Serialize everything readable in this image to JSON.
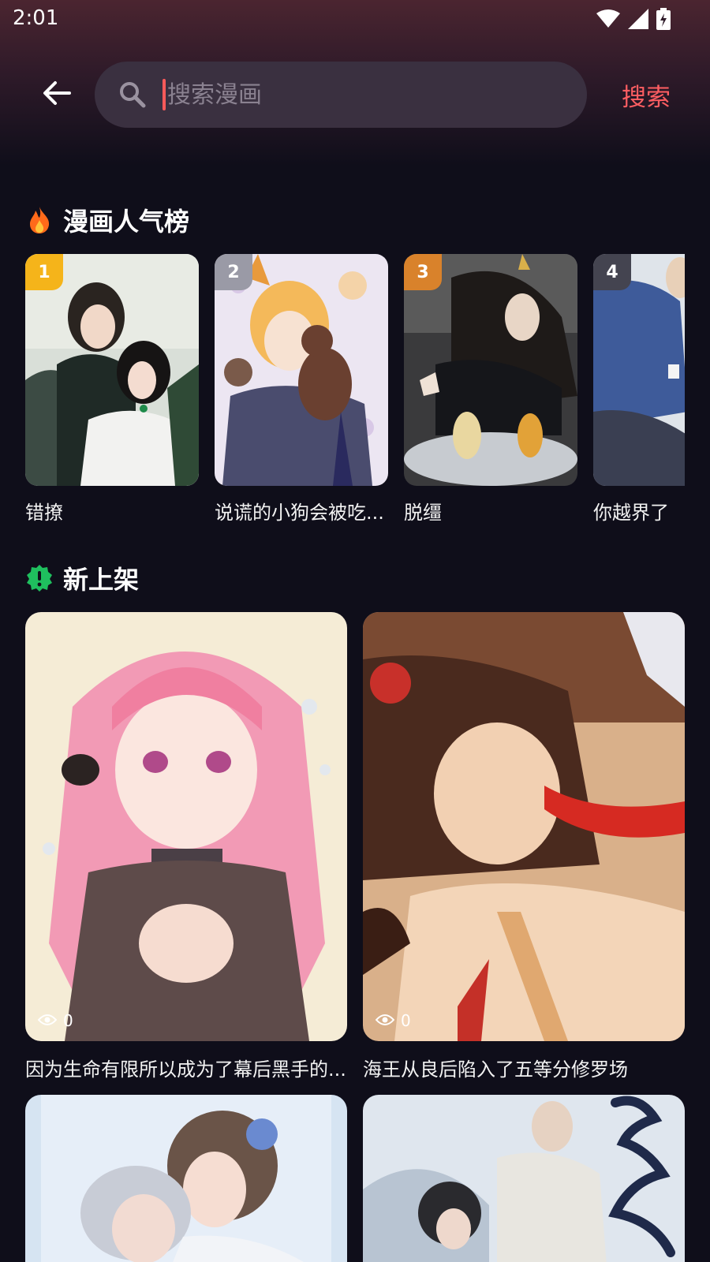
{
  "status_bar": {
    "time": "2:01"
  },
  "search": {
    "placeholder": "搜索漫画",
    "value": "",
    "submit_label": "搜索"
  },
  "popular": {
    "title": "漫画人气榜",
    "items": [
      {
        "rank": "1",
        "title": "错撩",
        "badge_color": "#f5b41a"
      },
      {
        "rank": "2",
        "title": "说谎的小狗会被吃...",
        "badge_color": "#9a9aa6"
      },
      {
        "rank": "3",
        "title": "脱缰",
        "badge_color": "#d9822b"
      },
      {
        "rank": "4",
        "title": "你越界了",
        "badge_color": "#444450"
      }
    ]
  },
  "new_releases": {
    "title": "新上架",
    "items": [
      {
        "title": "因为生命有限所以成为了幕后黑手的...",
        "views": "0"
      },
      {
        "title": "海王从良后陷入了五等分修罗场",
        "views": "0"
      },
      {
        "title": "",
        "views": ""
      },
      {
        "title": "",
        "views": ""
      }
    ]
  },
  "colors": {
    "accent": "#ff5e62",
    "background": "#0f0e1a",
    "search_bg": "#3a3040"
  }
}
